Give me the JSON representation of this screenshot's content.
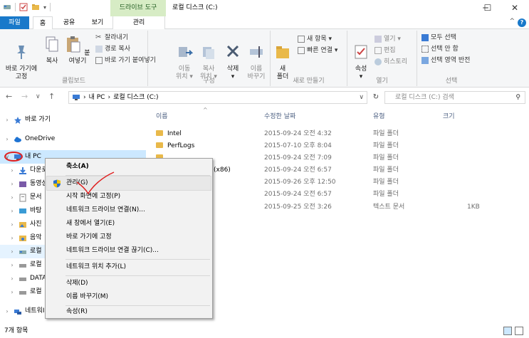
{
  "window": {
    "context_tool": "드라이브 도구",
    "title": "로컬 디스크 (C:)",
    "min": "─",
    "max": "☐",
    "close": "✕"
  },
  "tabs": {
    "file": "파일",
    "home": "홈",
    "share": "공유",
    "view": "보기",
    "manage": "관리"
  },
  "ribbon": {
    "clipboard": {
      "label": "클립보드",
      "pin": "바로 가기에\n고정",
      "copy": "복사",
      "paste": "붙여넣기",
      "cut": "잘라내기",
      "copy_path": "경로 복사",
      "paste_shortcut": "바로 가기 붙여넣기"
    },
    "organize": {
      "label": "구성",
      "move_to": "이동\n위치 ▾",
      "copy_to": "복사\n위치 ▾",
      "delete": "삭제\n▾",
      "rename": "이름\n바꾸기"
    },
    "new": {
      "label": "새로 만들기",
      "new_folder": "새\n폴더",
      "new_item": "새 항목 ▾",
      "easy_access": "빠른 연결 ▾"
    },
    "open": {
      "label": "열기",
      "properties": "속성\n▾",
      "open": "열기 ▾",
      "edit": "편집",
      "history": "히스토리"
    },
    "select": {
      "label": "선택",
      "select_all": "모두 선택",
      "select_none": "선택 안 함",
      "invert": "선택 영역 반전"
    }
  },
  "address": {
    "nav_back": "←",
    "nav_forward": "→",
    "nav_recent": "∨",
    "nav_up": "↑",
    "path_sep": "›",
    "crumb1": "내 PC",
    "crumb2": "로컬 디스크 (C:)",
    "dropdown": "∨",
    "refresh": "↻",
    "search_placeholder": "로컬 디스크 (C:) 검색",
    "search_icon": "⚲"
  },
  "nav_pane": [
    {
      "label": "바로 가기",
      "icon": "star-icon",
      "tw": "›"
    },
    {
      "label": "OneDrive",
      "icon": "cloud-icon",
      "tw": "›"
    },
    {
      "label": "내 PC",
      "icon": "pc-icon",
      "tw": "∨"
    },
    {
      "label": "다운로",
      "icon": "download-icon",
      "tw": "›"
    },
    {
      "label": "동영상",
      "icon": "video-icon",
      "tw": "›"
    },
    {
      "label": "문서",
      "icon": "document-icon",
      "tw": "›"
    },
    {
      "label": "바탕",
      "icon": "desktop-icon",
      "tw": "›"
    },
    {
      "label": "사진",
      "icon": "picture-icon",
      "tw": "›"
    },
    {
      "label": "음악",
      "icon": "music-icon",
      "tw": "›"
    },
    {
      "label": "로컬",
      "icon": "drive-icon",
      "tw": "›"
    },
    {
      "label": "로컬",
      "icon": "drive-icon",
      "tw": "›"
    },
    {
      "label": "DATA",
      "icon": "drive-icon",
      "tw": "›"
    },
    {
      "label": "로컬",
      "icon": "drive-icon",
      "tw": "›"
    },
    {
      "label": "네트워I",
      "icon": "network-icon",
      "tw": "›"
    }
  ],
  "columns": {
    "name": "이름",
    "modified": "수정한 날짜",
    "type": "유형",
    "size": "크기",
    "sort_arrow": "^"
  },
  "files": [
    {
      "name": "Intel",
      "date": "2015-09-24 오전 4:32",
      "type": "파일 폴더",
      "size": ""
    },
    {
      "name": "PerfLogs",
      "date": "2015-07-10 오후 8:04",
      "type": "파일 폴더",
      "size": ""
    },
    {
      "name": "",
      "date": "2015-09-24 오전 7:09",
      "type": "파일 폴더",
      "size": ""
    },
    {
      "name": "(x86)",
      "date": "2015-09-24 오전 6:57",
      "type": "파일 폴더",
      "size": ""
    },
    {
      "name": "",
      "date": "2015-09-26 오후 12:50",
      "type": "파일 폴더",
      "size": ""
    },
    {
      "name": "",
      "date": "2015-09-24 오전 6:57",
      "type": "파일 폴더",
      "size": ""
    },
    {
      "name": "",
      "date": "2015-09-25 오전 3:26",
      "type": "텍스트 문서",
      "size": "1KB"
    }
  ],
  "status": {
    "count": "7개 항목"
  },
  "context_menu": {
    "collapse": "축소(A)",
    "manage": "관리(G)",
    "pin_start": "시작 화면에 고정(P)",
    "map_drive": "네트워크 드라이브 연결(N)...",
    "open_new": "새 창에서 열기(E)",
    "pin_quick": "바로 가기에 고정",
    "disconnect": "네트워크 드라이브 연결 끊기(C)...",
    "add_network": "네트워크 위치 추가(L)",
    "delete": "삭제(D)",
    "rename": "이름 바꾸기(M)",
    "properties": "속성(R)"
  }
}
